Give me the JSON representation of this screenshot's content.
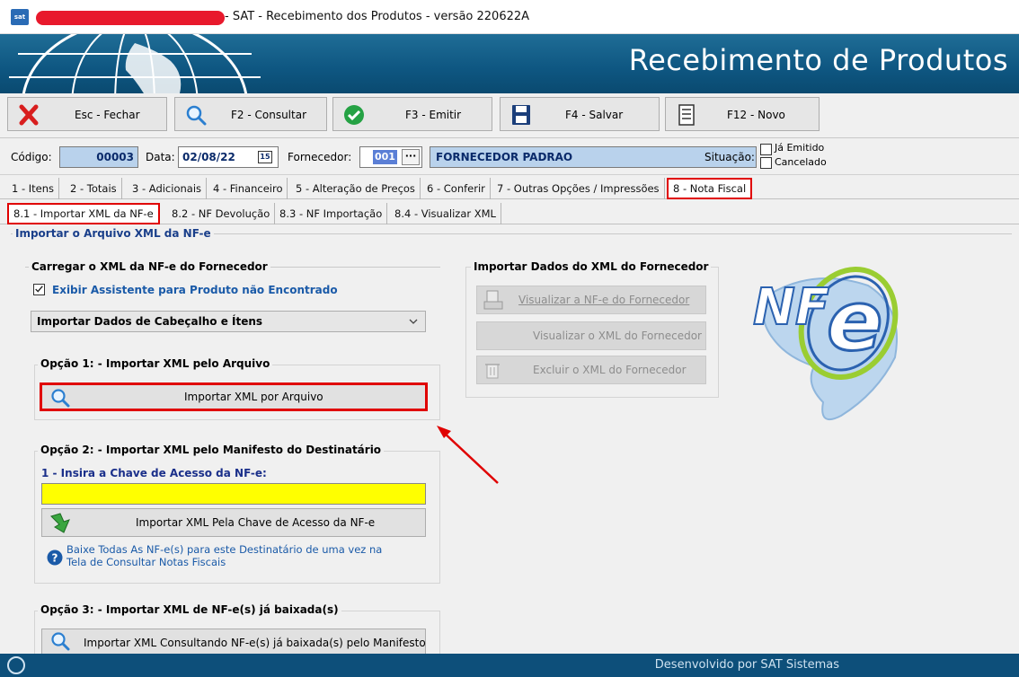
{
  "window": {
    "title": "- SAT - Recebimento dos Produtos - versão 220622A",
    "app_icon_text": "sat"
  },
  "banner": {
    "title": "Recebimento de Produtos"
  },
  "toolbar": {
    "close": "Esc - Fechar",
    "consult": "F2 - Consultar",
    "emit": "F3 - Emitir",
    "save": "F4 - Salvar",
    "new": "F12 - Novo"
  },
  "fields": {
    "codigo_label": "Código:",
    "codigo_value": "00003",
    "data_label": "Data:",
    "data_value": "02/08/22",
    "calendar_glyph": "15",
    "fornecedor_label": "Fornecedor:",
    "fornecedor_code": "001",
    "lookup_glyph": "···",
    "fornecedor_name": "FORNECEDOR PADRAO",
    "situacao_label": "Situação:",
    "ja_emitido": "Já Emitido",
    "cancelado": "Cancelado"
  },
  "main_tabs": [
    "1 - Itens",
    "2 - Totais",
    "3 - Adicionais",
    "4 - Financeiro",
    "5 - Alteração de Preços",
    "6 - Conferir",
    "7 - Outras Opções / Impressões",
    "8 - Nota Fiscal"
  ],
  "sub_tabs": [
    "8.1 - Importar XML da NF-e",
    "8.2 - NF Devolução",
    "8.3 - NF Importação",
    "8.4 - Visualizar XML"
  ],
  "section_title": "Importar o Arquivo XML da NF-e",
  "carregar": {
    "title": "Carregar o XML da NF-e do Fornecedor",
    "checkbox_label": "Exibir Assistente para Produto não Encontrado",
    "select_value": "Importar Dados de Cabeçalho e Ítens"
  },
  "opcao1": {
    "title": "Opção 1: - Importar XML pelo Arquivo",
    "button": "Importar XML por Arquivo"
  },
  "opcao2": {
    "title": "Opção 2: - Importar XML pelo Manifesto do Destinatário",
    "key_label": "1 - Insira a Chave de Acesso da NF-e:",
    "key_value": "",
    "button": "Importar XML Pela Chave de Acesso da NF-e",
    "help_line1": "Baixe Todas As NF-e(s) para este Destinatário de uma vez na",
    "help_line2": "Tela de Consultar Notas Fiscais"
  },
  "opcao3": {
    "title": "Opção 3: - Importar XML de NF-e(s) já baixada(s)",
    "button": "Importar XML Consultando NF-e(s) já baixada(s) pelo Manifesto"
  },
  "fornecedor_xml": {
    "title": "Importar Dados do XML do Fornecedor",
    "btn_view_nfe": "Visualizar a NF-e do Fornecedor",
    "btn_view_xml": "Visualizar o XML do Fornecedor",
    "btn_delete_xml": "Excluir o XML do Fornecedor"
  },
  "logo": {
    "text_nf": "NF",
    "text_e": "e"
  },
  "status": {
    "text": "Desenvolvido por SAT Sistemas"
  },
  "colors": {
    "accent_red": "#e00000",
    "banner_blue": "#0e5681",
    "key_yellow": "#ffff00",
    "link_blue": "#1a5aa8"
  }
}
